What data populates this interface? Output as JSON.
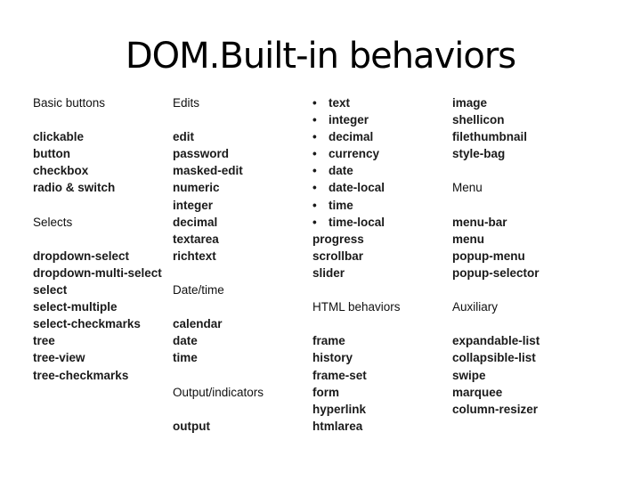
{
  "title": "DOM.Built-in behaviors",
  "columns": [
    [
      {
        "t": "hdr",
        "text": "Basic buttons"
      },
      {
        "t": "gap"
      },
      {
        "t": "item",
        "text": "clickable"
      },
      {
        "t": "item",
        "text": "button"
      },
      {
        "t": "item",
        "text": "checkbox"
      },
      {
        "t": "item",
        "text": "radio & switch"
      },
      {
        "t": "gap"
      },
      {
        "t": "hdr",
        "text": "Selects"
      },
      {
        "t": "gap"
      },
      {
        "t": "item",
        "text": "dropdown-select"
      },
      {
        "t": "item",
        "text": "dropdown-multi-select"
      },
      {
        "t": "item",
        "text": "select"
      },
      {
        "t": "item",
        "text": "select-multiple"
      },
      {
        "t": "item",
        "text": "select-checkmarks"
      },
      {
        "t": "item",
        "text": "tree"
      },
      {
        "t": "item",
        "text": "tree-view"
      },
      {
        "t": "item",
        "text": "tree-checkmarks"
      }
    ],
    [
      {
        "t": "hdr",
        "text": "Edits"
      },
      {
        "t": "gap"
      },
      {
        "t": "item",
        "text": "edit"
      },
      {
        "t": "item",
        "text": "password"
      },
      {
        "t": "item",
        "text": "masked-edit"
      },
      {
        "t": "item",
        "text": "numeric"
      },
      {
        "t": "item",
        "text": "integer"
      },
      {
        "t": "item",
        "text": "decimal"
      },
      {
        "t": "item",
        "text": "textarea"
      },
      {
        "t": "item",
        "text": "richtext"
      },
      {
        "t": "gap"
      },
      {
        "t": "hdr",
        "text": "Date/time"
      },
      {
        "t": "gap"
      },
      {
        "t": "item",
        "text": "calendar"
      },
      {
        "t": "item",
        "text": "date"
      },
      {
        "t": "item",
        "text": "time"
      },
      {
        "t": "gap"
      },
      {
        "t": "hdr",
        "text": "Output/indicators"
      },
      {
        "t": "gap"
      },
      {
        "t": "item",
        "text": "output"
      }
    ],
    [
      {
        "t": "bullet",
        "text": "text"
      },
      {
        "t": "bullet",
        "text": "integer"
      },
      {
        "t": "bullet",
        "text": "decimal"
      },
      {
        "t": "bullet",
        "text": "currency"
      },
      {
        "t": "bullet",
        "text": "date"
      },
      {
        "t": "bullet",
        "text": "date-local"
      },
      {
        "t": "bullet",
        "text": "time"
      },
      {
        "t": "bullet",
        "text": "time-local"
      },
      {
        "t": "item",
        "text": "progress"
      },
      {
        "t": "item",
        "text": "scrollbar"
      },
      {
        "t": "item",
        "text": "slider"
      },
      {
        "t": "gap"
      },
      {
        "t": "hdr",
        "text": "HTML behaviors"
      },
      {
        "t": "gap"
      },
      {
        "t": "item",
        "text": "frame"
      },
      {
        "t": "item",
        "text": "history"
      },
      {
        "t": "item",
        "text": "frame-set"
      },
      {
        "t": "item",
        "text": "form"
      },
      {
        "t": "item",
        "text": "hyperlink"
      },
      {
        "t": "item",
        "text": "htmlarea"
      }
    ],
    [
      {
        "t": "item",
        "text": "image"
      },
      {
        "t": "item",
        "text": "shellicon"
      },
      {
        "t": "item",
        "text": "filethumbnail"
      },
      {
        "t": "item",
        "text": "style-bag"
      },
      {
        "t": "gap"
      },
      {
        "t": "hdr",
        "text": "Menu"
      },
      {
        "t": "gap"
      },
      {
        "t": "item",
        "text": "menu-bar"
      },
      {
        "t": "item",
        "text": "menu"
      },
      {
        "t": "item",
        "text": "popup-menu"
      },
      {
        "t": "item",
        "text": "popup-selector"
      },
      {
        "t": "gap"
      },
      {
        "t": "hdr",
        "text": "Auxiliary"
      },
      {
        "t": "gap"
      },
      {
        "t": "item",
        "text": "expandable-list"
      },
      {
        "t": "item",
        "text": "collapsible-list"
      },
      {
        "t": "item",
        "text": "swipe"
      },
      {
        "t": "item",
        "text": "marquee"
      },
      {
        "t": "item",
        "text": "column-resizer"
      }
    ]
  ],
  "bullet_glyph": "•"
}
